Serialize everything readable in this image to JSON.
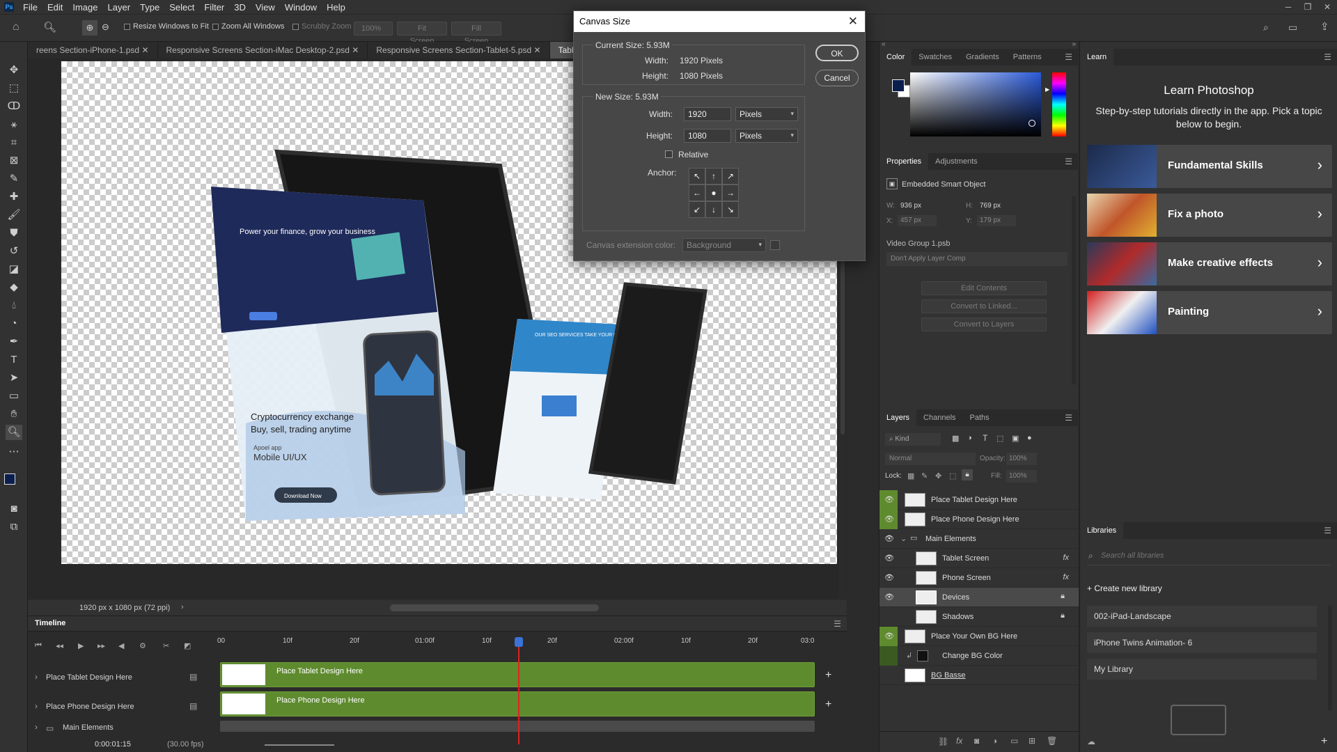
{
  "menu": [
    "File",
    "Edit",
    "Image",
    "Layer",
    "Type",
    "Select",
    "Filter",
    "3D",
    "View",
    "Window",
    "Help"
  ],
  "app_logo": "Ps",
  "window_controls": [
    "─",
    "❐",
    "✕"
  ],
  "options": {
    "resize_windows": "Resize Windows to Fit",
    "zoom_all": "Zoom All Windows",
    "scrubby_zoom": "Scrubby Zoom",
    "zoom_value": "100%",
    "fit_screen": "Fit Screen",
    "fill_screen": "Fill Screen"
  },
  "tabs": [
    "reens Section-iPhone-1.psd",
    "Responsive Screens Section-iMac Desktop-2.psd",
    "Responsive Screens Section-Tablet-5.psd",
    "Tablet and iPh"
  ],
  "canvas_content": {
    "tablet_headline": "Power your finance, grow your business",
    "crypto_headline": "Cryptocurrency exchange",
    "crypto_sub": "Buy, sell, trading anytime",
    "app_label": "Apoel app",
    "mobile_label": "Mobile  UI/UX",
    "download_btn": "Download Now",
    "seo_text": "OUR SEO SERVICES TAKE YOUR BUSINESS TO NEW HEIGHTS"
  },
  "status": {
    "doc_size": "1920 px x 1080 px (72 ppi)"
  },
  "timeline": {
    "title": "Timeline",
    "ticks": [
      "00",
      "10f",
      "20f",
      "01:00f",
      "10f",
      "20f",
      "02:00f",
      "10f",
      "20f",
      "03:0"
    ],
    "tracks": [
      {
        "name": "Place Tablet Design Here",
        "clip": "Place Tablet Design Here"
      },
      {
        "name": "Place Phone Design Here",
        "clip": "Place Phone Design Here"
      },
      {
        "name": "Main Elements"
      }
    ],
    "timecode": "0:00:01:15",
    "fps": "(30.00 fps)"
  },
  "dialog": {
    "title": "Canvas Size",
    "current_size": "Current Size: 5.93M",
    "current_width_label": "Width:",
    "current_width": "1920 Pixels",
    "current_height_label": "Height:",
    "current_height": "1080 Pixels",
    "new_size": "New Size: 5.93M",
    "width_label": "Width:",
    "width_value": "1920",
    "height_label": "Height:",
    "height_value": "1080",
    "unit": "Pixels",
    "relative_label": "Relative",
    "anchor_label": "Anchor:",
    "anchor_glyphs": [
      "↖",
      "↑",
      "↗",
      "←",
      "●",
      "→",
      "↙",
      "↓",
      "↘"
    ],
    "ext_color_label": "Canvas extension color:",
    "ext_color_value": "Background",
    "ok": "OK",
    "cancel": "Cancel"
  },
  "color_panel": {
    "tabs": [
      "Color",
      "Swatches",
      "Gradients",
      "Patterns"
    ],
    "fg": "#0a1f4d",
    "bg": "#ffffff"
  },
  "properties": {
    "tabs": [
      "Properties",
      "Adjustments"
    ],
    "type": "Embedded Smart Object",
    "w_label": "W:",
    "w": "936 px",
    "h_label": "H:",
    "h": "769 px",
    "x_label": "X:",
    "x": "457 px",
    "y_label": "Y:",
    "y": "179 px",
    "file": "Video Group 1.psb",
    "layer_comp": "Don't Apply Layer Comp",
    "buttons": [
      "Edit Contents",
      "Convert to Linked...",
      "Convert to Layers"
    ]
  },
  "layers_panel": {
    "tabs": [
      "Layers",
      "Channels",
      "Paths"
    ],
    "kind": "Kind",
    "blend": "Normal",
    "opacity_label": "Opacity:",
    "opacity": "100%",
    "lock_label": "Lock:",
    "fill_label": "Fill:",
    "fill": "100%",
    "layers": [
      {
        "name": "Place Tablet Design Here",
        "visible": true,
        "indent": 0
      },
      {
        "name": "Place Phone Design Here",
        "visible": true,
        "indent": 0
      },
      {
        "name": "Main Elements",
        "visible": true,
        "indent": 0,
        "group": true
      },
      {
        "name": "Tablet Screen",
        "visible": true,
        "indent": 1,
        "fx": true
      },
      {
        "name": "Phone Screen",
        "visible": true,
        "indent": 1,
        "fx": true
      },
      {
        "name": "Devices",
        "visible": true,
        "indent": 1,
        "locked": true,
        "selected": true
      },
      {
        "name": "Shadows",
        "visible": false,
        "indent": 1,
        "locked": true
      },
      {
        "name": "Place Your Own BG Here",
        "visible": true,
        "indent": 0
      },
      {
        "name": "Change BG Color",
        "visible": false,
        "indent": 0,
        "clip": true
      },
      {
        "name": "BG Basse",
        "visible": false,
        "indent": 0
      }
    ]
  },
  "learn": {
    "tab": "Learn",
    "title": "Learn Photoshop",
    "subtitle": "Step-by-step tutorials directly in the app. Pick a topic below to begin.",
    "cards": [
      "Fundamental Skills",
      "Fix a photo",
      "Make creative effects",
      "Painting"
    ]
  },
  "libraries": {
    "tab": "Libraries",
    "search_placeholder": "Search all libraries",
    "create": "Create new library",
    "items": [
      "002-iPad-Landscape",
      "iPhone Twins Animation- 6",
      "My Library"
    ]
  },
  "colors": {
    "accent_green": "#5f8b2f",
    "playhead": "#e02020"
  }
}
